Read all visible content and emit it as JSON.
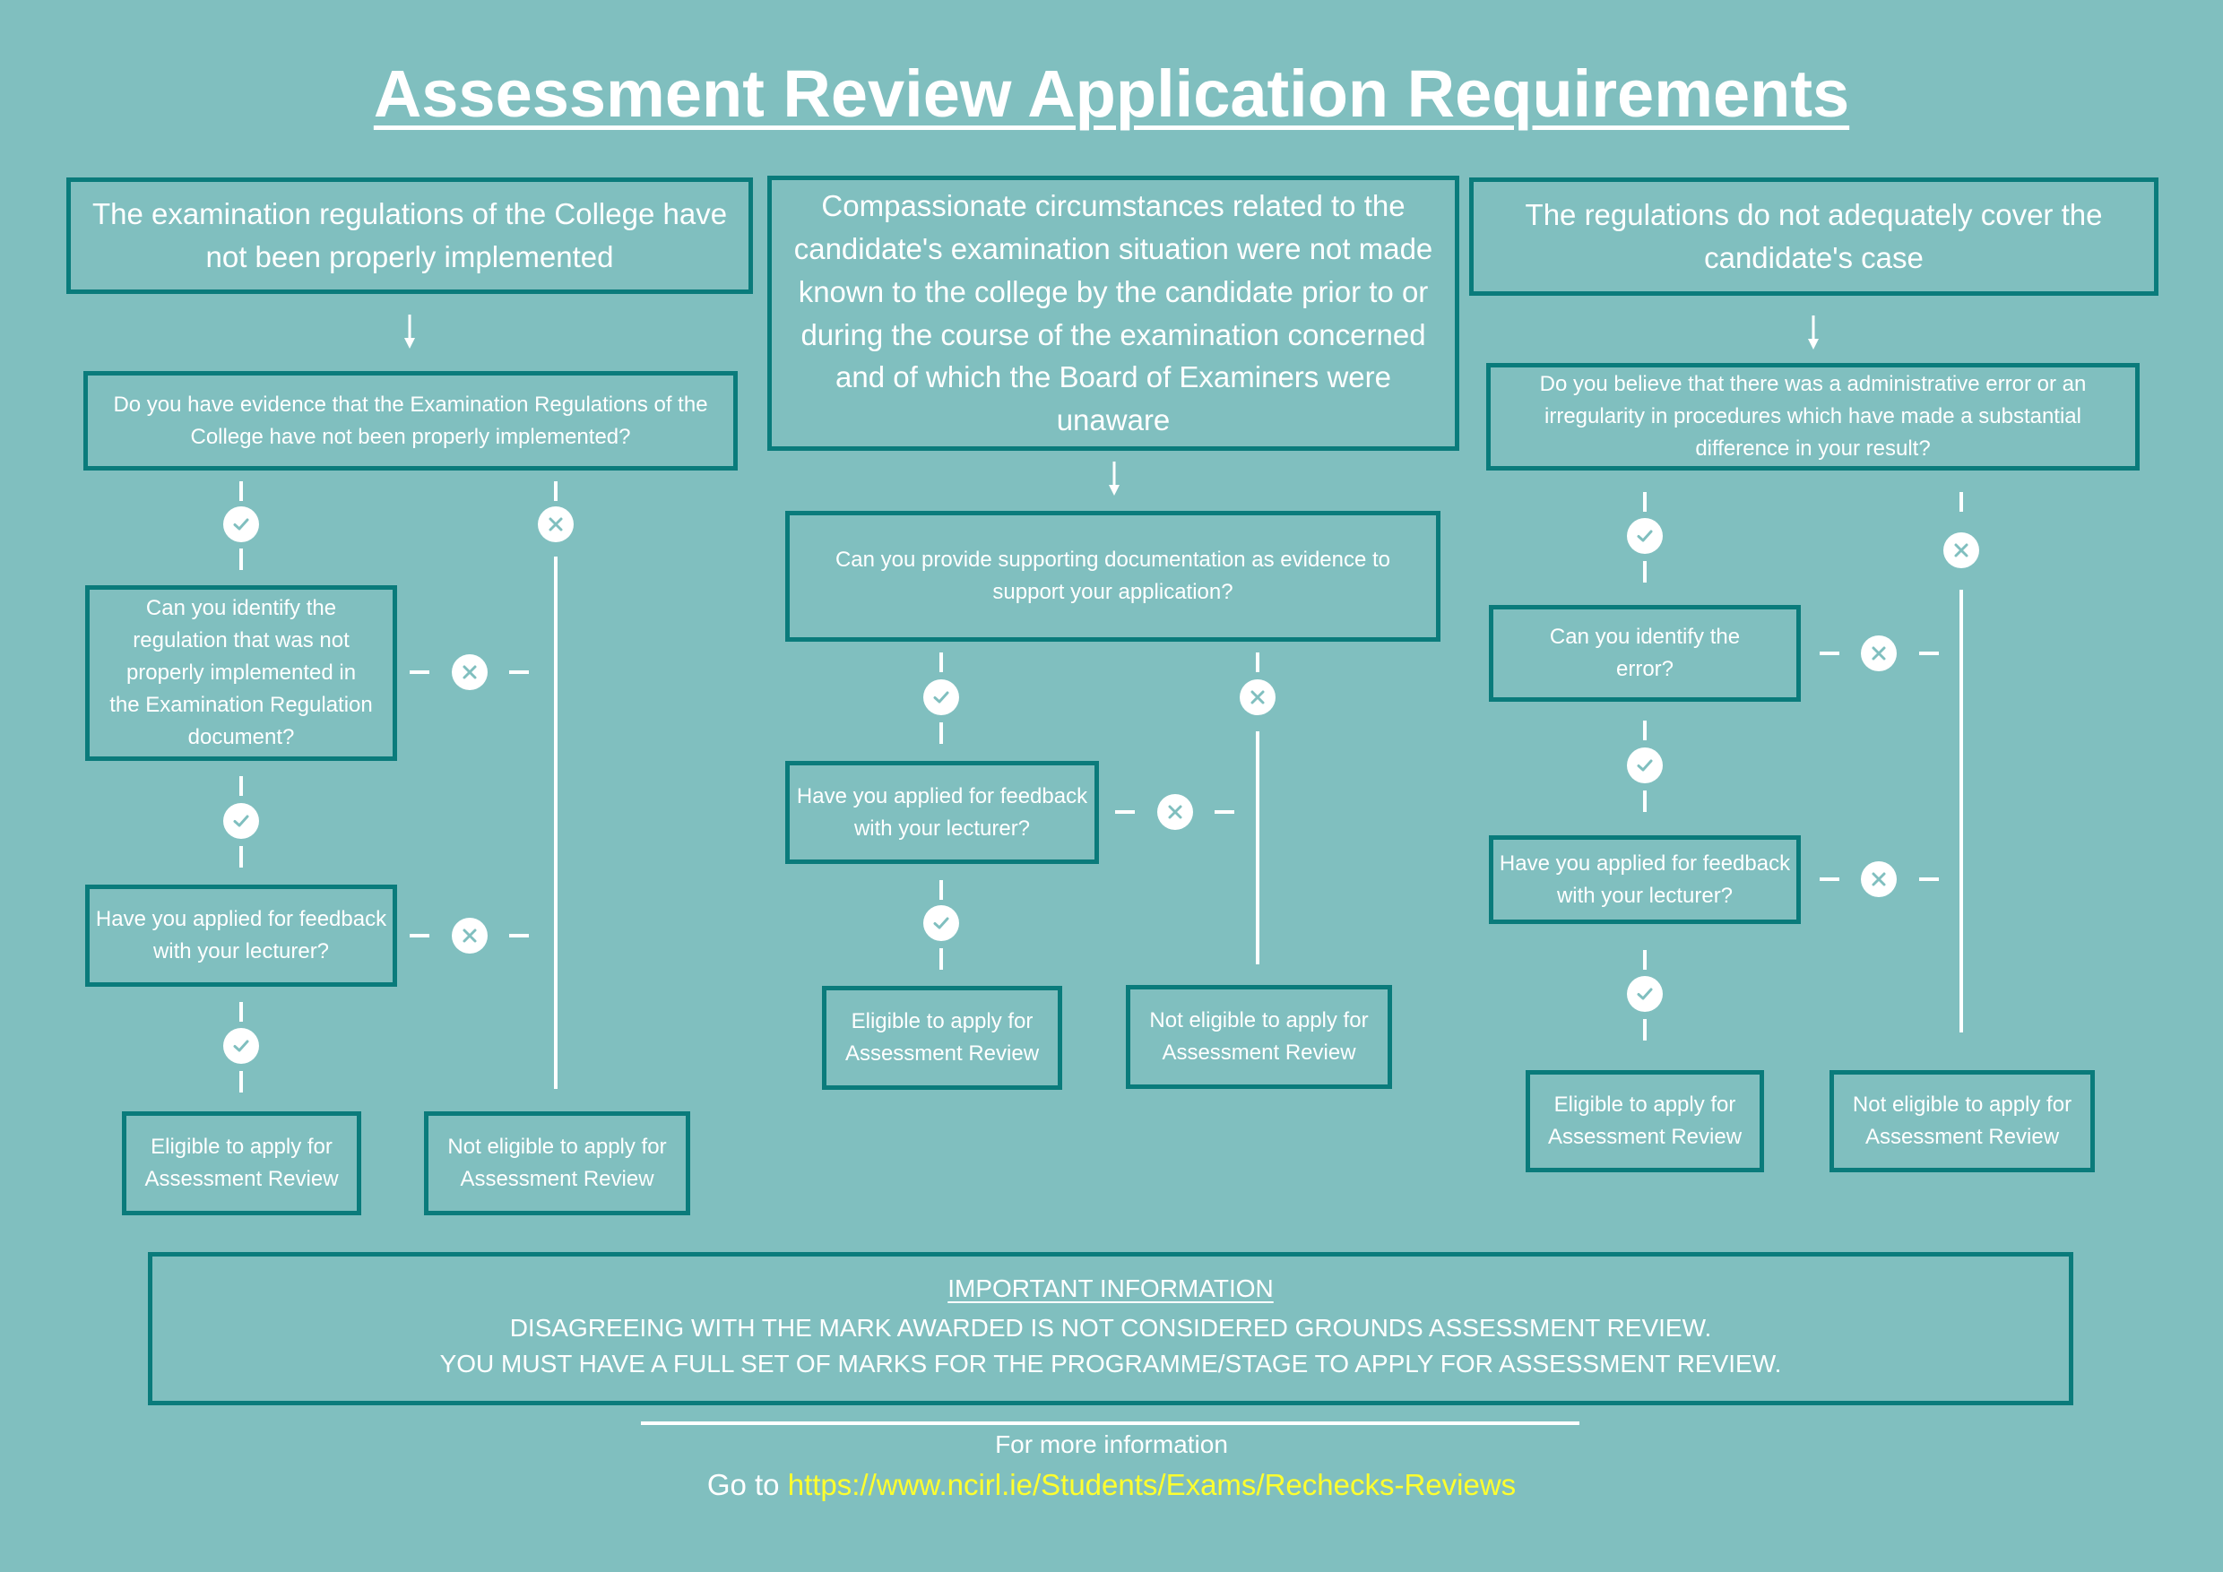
{
  "title": "Assessment Review Application Requirements",
  "colors": {
    "background": "#80bfbf",
    "box_border": "#0a7b7b",
    "text": "#ffffff",
    "link": "#ffff2e"
  },
  "icons": {
    "yes": "check-circle-icon",
    "no": "x-circle-icon",
    "flow": "arrow-down-icon"
  },
  "columns": [
    {
      "heading": "The examination regulations of the College have not been properly implemented",
      "question": "Do you have evidence that the Examination Regulations of the College have not been properly implemented?",
      "step2": "Can you identify the regulation that was not properly implemented in the Examination Regulation document?",
      "step3": "Have you applied for feedback with your lecturer?",
      "eligible": "Eligible to apply for Assessment Review",
      "not_eligible": "Not eligible to apply for Assessment Review"
    },
    {
      "heading": "Compassionate circumstances related to the candidate's examination situation were not made known to the college by the candidate prior to or during the course of the examination concerned and of which the Board of Examiners were unaware",
      "question": "Can you provide supporting documentation as evidence to support your application?",
      "step2": "Have you applied for feedback with your lecturer?",
      "eligible": "Eligible to apply for Assessment Review",
      "not_eligible": "Not eligible to apply for Assessment Review"
    },
    {
      "heading": "The regulations do not adequately cover the candidate's case",
      "question": "Do you believe that there was a administrative error or an irregularity in procedures which have made a substantial difference in your result?",
      "step2": "Can you identify the error?",
      "step3": "Have you applied for feedback with your lecturer?",
      "eligible": "Eligible to apply for Assessment Review",
      "not_eligible": "Not eligible to apply for Assessment Review"
    }
  ],
  "important": {
    "heading": "IMPORTANT INFORMATION",
    "lines": [
      "DISAGREEING WITH THE MARK AWARDED IS NOT CONSIDERED GROUNDS ASSESSMENT REVIEW.",
      "YOU MUST HAVE A FULL SET OF MARKS FOR THE PROGRAMME/STAGE TO APPLY FOR ASSESSMENT REVIEW."
    ]
  },
  "footer": {
    "more_info": "For more information",
    "goto_prefix": "Go to",
    "link_text": "https://www.ncirl.ie/Students/Exams/Rechecks-Reviews"
  }
}
